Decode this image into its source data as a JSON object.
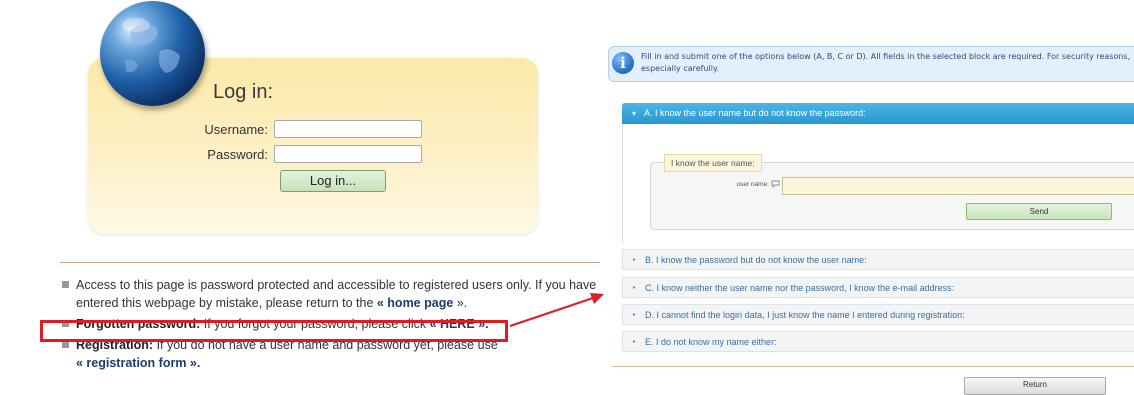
{
  "login": {
    "title": "Log in:",
    "username_label": "Username:",
    "password_label": "Password:",
    "username_value": "",
    "password_value": "",
    "submit_label": "Log in..."
  },
  "info": {
    "access_text": "Access to this page is password protected and accessible to registered users only. If you have entered this webpage by mistake, please return to the ",
    "access_link": "« home page",
    "access_end": " ».",
    "forgot_label": "Forgotten password:",
    "forgot_text": " If you forgot your password, please click ",
    "forgot_link": "« HERE ».",
    "reg_label": "Registration:",
    "reg_text": " If you do not have a user name and password yet, please use",
    "reg_link": "« registration form »."
  },
  "notice": {
    "line1": "Fill in and submit one of the options below (A, B, C or D). All fields in the selected block are required. For security reasons, y",
    "line2": "especially carefully."
  },
  "accordion": {
    "a_title": "A. I know the user name but do not know the password:",
    "a_legend": "I know the user name:",
    "a_field_label": "user name:",
    "a_field_value": "",
    "a_send": "Send",
    "b_title": "B. I know the password but do not know the user name:",
    "c_title": "C. I know neither the user name nor the password, I know the e-mail address:",
    "d_title": "D. I cannot find the login data, I just know the name I entered during registration:",
    "e_title": "E. I do not know my name either:"
  },
  "return_label": "Return",
  "colors": {
    "accent_blue": "#2a97d2",
    "highlight_red": "#e01b24",
    "login_bg": "#fbe9a8",
    "button_green": "#c6e2ba"
  }
}
